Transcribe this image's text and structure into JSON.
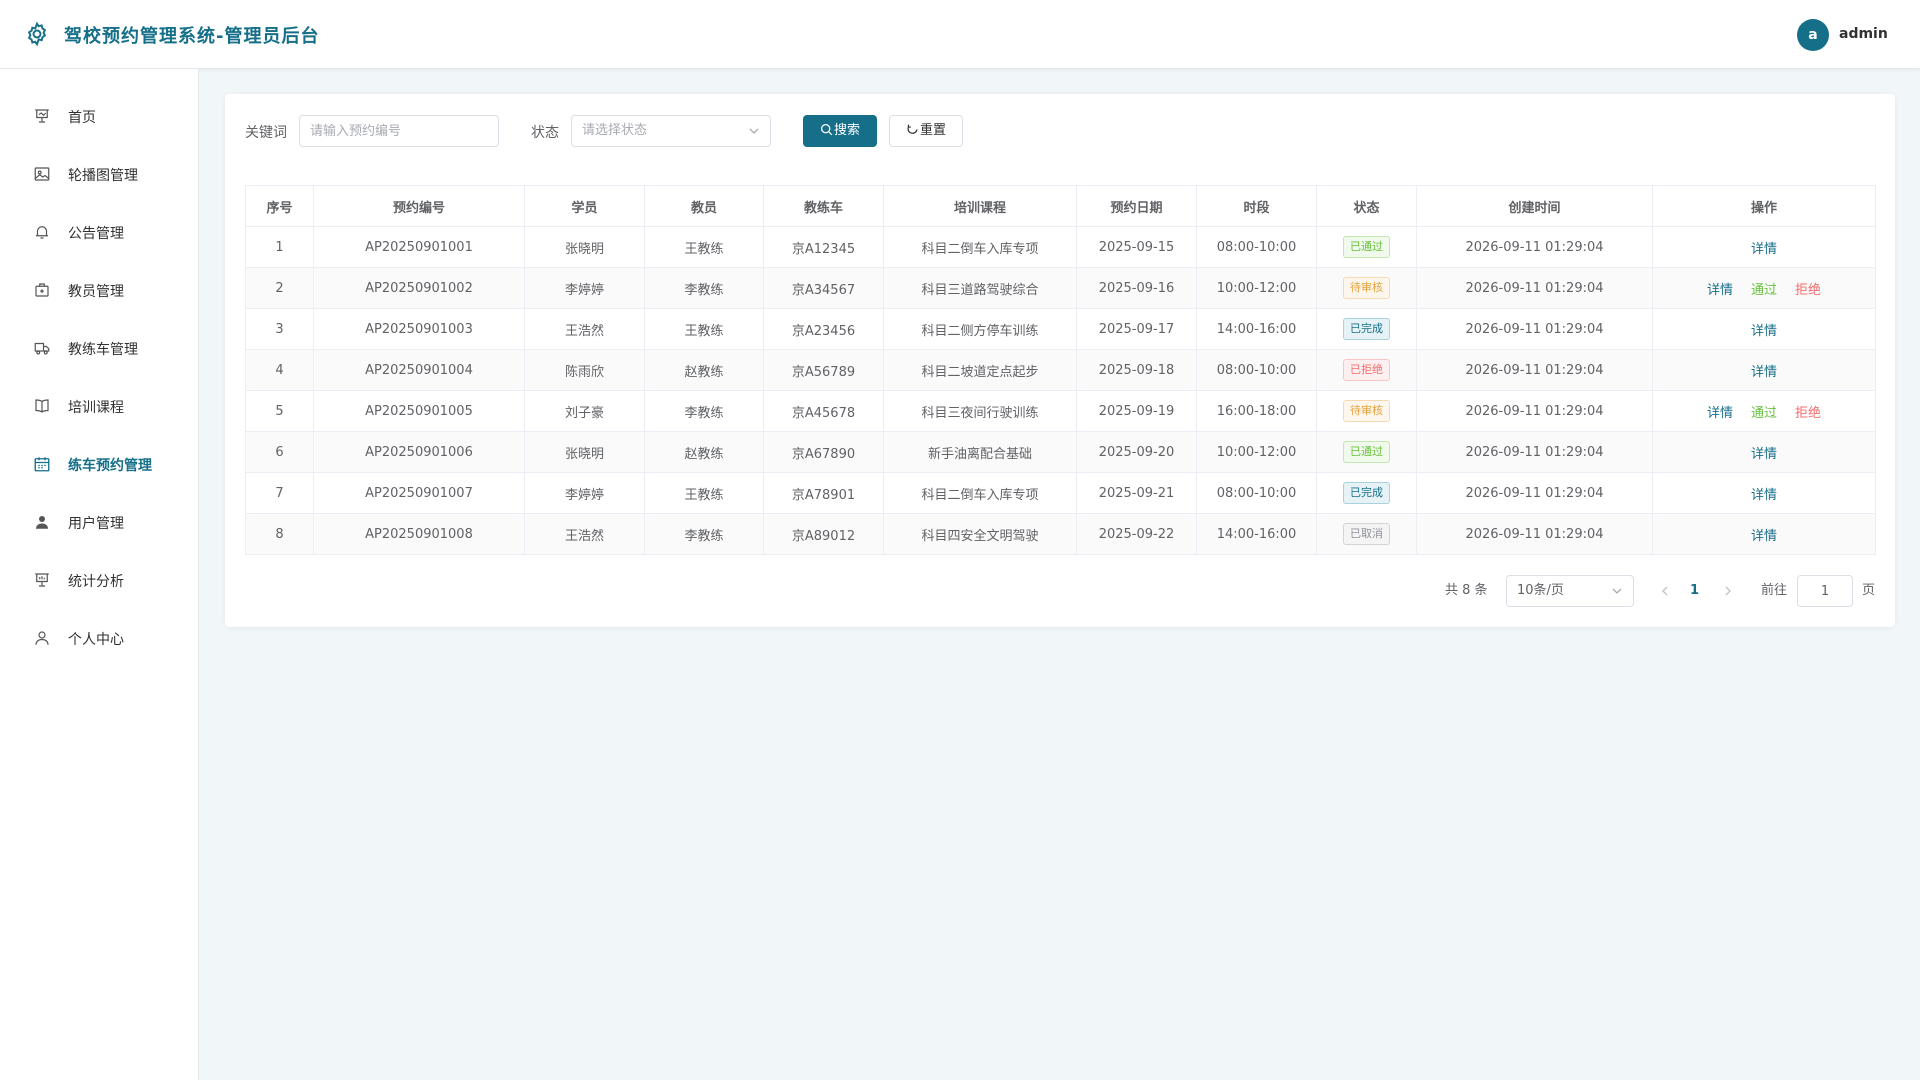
{
  "header": {
    "title": "驾校预约管理系统-管理员后台",
    "avatar_letter": "a",
    "username": "admin"
  },
  "sidebar": {
    "items": [
      {
        "label": "首页",
        "icon": "dashboard-icon"
      },
      {
        "label": "轮播图管理",
        "icon": "image-icon"
      },
      {
        "label": "公告管理",
        "icon": "bell-icon"
      },
      {
        "label": "教员管理",
        "icon": "briefcase-icon"
      },
      {
        "label": "教练车管理",
        "icon": "truck-icon"
      },
      {
        "label": "培训课程",
        "icon": "book-icon"
      },
      {
        "label": "练车预约管理",
        "icon": "calendar-icon"
      },
      {
        "label": "用户管理",
        "icon": "user-filled-icon"
      },
      {
        "label": "统计分析",
        "icon": "chart-icon"
      },
      {
        "label": "个人中心",
        "icon": "user-icon"
      }
    ],
    "active_index": 6
  },
  "filters": {
    "keyword_label": "关键词",
    "keyword_placeholder": "请输入预约编号",
    "keyword_value": "",
    "status_label": "状态",
    "status_placeholder": "请选择状态",
    "search_label": "搜索",
    "reset_label": "重置"
  },
  "table": {
    "columns": [
      "序号",
      "预约编号",
      "学员",
      "教员",
      "教练车",
      "培训课程",
      "预约日期",
      "时段",
      "状态",
      "创建时间",
      "操作"
    ],
    "rows": [
      {
        "no": "1",
        "code": "AP20250901001",
        "student": "张晓明",
        "coach": "王教练",
        "car": "京A12345",
        "course": "科目二倒车入库专项",
        "date": "2025-09-15",
        "slot": "08:00-10:00",
        "status": "已通过",
        "status_type": "approved",
        "created": "2026-09-11 01:29:04",
        "actions": [
          "详情"
        ]
      },
      {
        "no": "2",
        "code": "AP20250901002",
        "student": "李婷婷",
        "coach": "李教练",
        "car": "京A34567",
        "course": "科目三道路驾驶综合",
        "date": "2025-09-16",
        "slot": "10:00-12:00",
        "status": "待审核",
        "status_type": "pending",
        "created": "2026-09-11 01:29:04",
        "actions": [
          "详情",
          "通过",
          "拒绝"
        ]
      },
      {
        "no": "3",
        "code": "AP20250901003",
        "student": "王浩然",
        "coach": "王教练",
        "car": "京A23456",
        "course": "科目二侧方停车训练",
        "date": "2025-09-17",
        "slot": "14:00-16:00",
        "status": "已完成",
        "status_type": "done",
        "created": "2026-09-11 01:29:04",
        "actions": [
          "详情"
        ]
      },
      {
        "no": "4",
        "code": "AP20250901004",
        "student": "陈雨欣",
        "coach": "赵教练",
        "car": "京A56789",
        "course": "科目二坡道定点起步",
        "date": "2025-09-18",
        "slot": "08:00-10:00",
        "status": "已拒绝",
        "status_type": "rejected",
        "created": "2026-09-11 01:29:04",
        "actions": [
          "详情"
        ]
      },
      {
        "no": "5",
        "code": "AP20250901005",
        "student": "刘子豪",
        "coach": "李教练",
        "car": "京A45678",
        "course": "科目三夜间行驶训练",
        "date": "2025-09-19",
        "slot": "16:00-18:00",
        "status": "待审核",
        "status_type": "pending",
        "created": "2026-09-11 01:29:04",
        "actions": [
          "详情",
          "通过",
          "拒绝"
        ]
      },
      {
        "no": "6",
        "code": "AP20250901006",
        "student": "张晓明",
        "coach": "赵教练",
        "car": "京A67890",
        "course": "新手油离配合基础",
        "date": "2025-09-20",
        "slot": "10:00-12:00",
        "status": "已通过",
        "status_type": "approved",
        "created": "2026-09-11 01:29:04",
        "actions": [
          "详情"
        ]
      },
      {
        "no": "7",
        "code": "AP20250901007",
        "student": "李婷婷",
        "coach": "王教练",
        "car": "京A78901",
        "course": "科目二倒车入库专项",
        "date": "2025-09-21",
        "slot": "08:00-10:00",
        "status": "已完成",
        "status_type": "done",
        "created": "2026-09-11 01:29:04",
        "actions": [
          "详情"
        ]
      },
      {
        "no": "8",
        "code": "AP20250901008",
        "student": "王浩然",
        "coach": "李教练",
        "car": "京A89012",
        "course": "科目四安全文明驾驶",
        "date": "2025-09-22",
        "slot": "14:00-16:00",
        "status": "已取消",
        "status_type": "cancel",
        "created": "2026-09-11 01:29:04",
        "actions": [
          "详情"
        ]
      }
    ]
  },
  "pagination": {
    "total_text": "共 8 条",
    "page_size": "10条/页",
    "current_page": "1",
    "goto_label": "前往",
    "goto_value": "1",
    "page_suffix": "页"
  },
  "colors": {
    "primary": "#166f89",
    "success": "#67c23a",
    "warning": "#e6a23c",
    "danger": "#f56c6c",
    "info": "#909399"
  }
}
